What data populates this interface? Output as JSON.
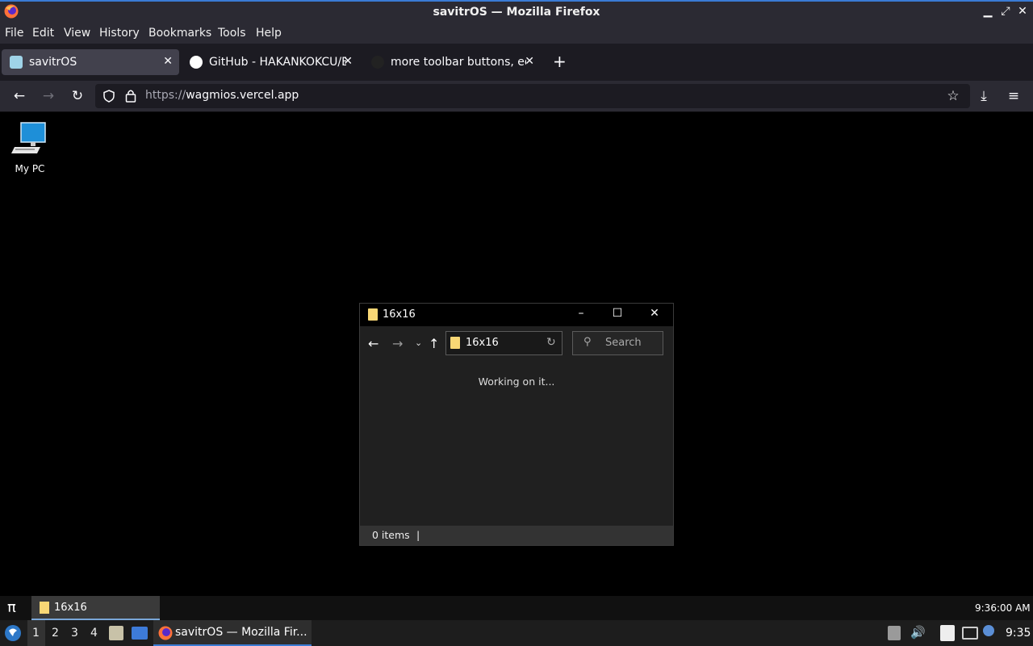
{
  "firefox": {
    "window_title": "savitrOS — Mozilla Firefox",
    "menu": [
      "File",
      "Edit",
      "View",
      "History",
      "Bookmarks",
      "Tools",
      "Help"
    ],
    "tabs": [
      {
        "label": "savitrOS",
        "active": true
      },
      {
        "label": "GitHub - HAKANKOKCU/B",
        "active": false
      },
      {
        "label": "more toolbar buttons, ed",
        "active": false
      }
    ],
    "new_tab": "+",
    "url_protocol": "https://",
    "url_host": "wagmios.vercel.app"
  },
  "desktop": {
    "icons": [
      {
        "label": "My PC",
        "icon": "computer-icon"
      }
    ]
  },
  "explorer": {
    "title": "16x16",
    "address": "16x16",
    "search_placeholder": "Search",
    "loading_text": "Working on it...",
    "status_items": "0 items",
    "status_sep": "|"
  },
  "inner_taskbar": {
    "start_glyph": "π",
    "task_label": "16x16",
    "clock": "9:36:00 AM"
  },
  "system_taskbar": {
    "workspaces": [
      "1",
      "2",
      "3",
      "4"
    ],
    "active_workspace": "1",
    "window_label": "savitrOS — Mozilla Fir...",
    "clock": "9:35"
  },
  "colors": {
    "accent": "#3a7bd5",
    "folder": "#f8d775",
    "firefox_chrome": "#2b2a33",
    "tabstrip": "#1c1b22"
  }
}
